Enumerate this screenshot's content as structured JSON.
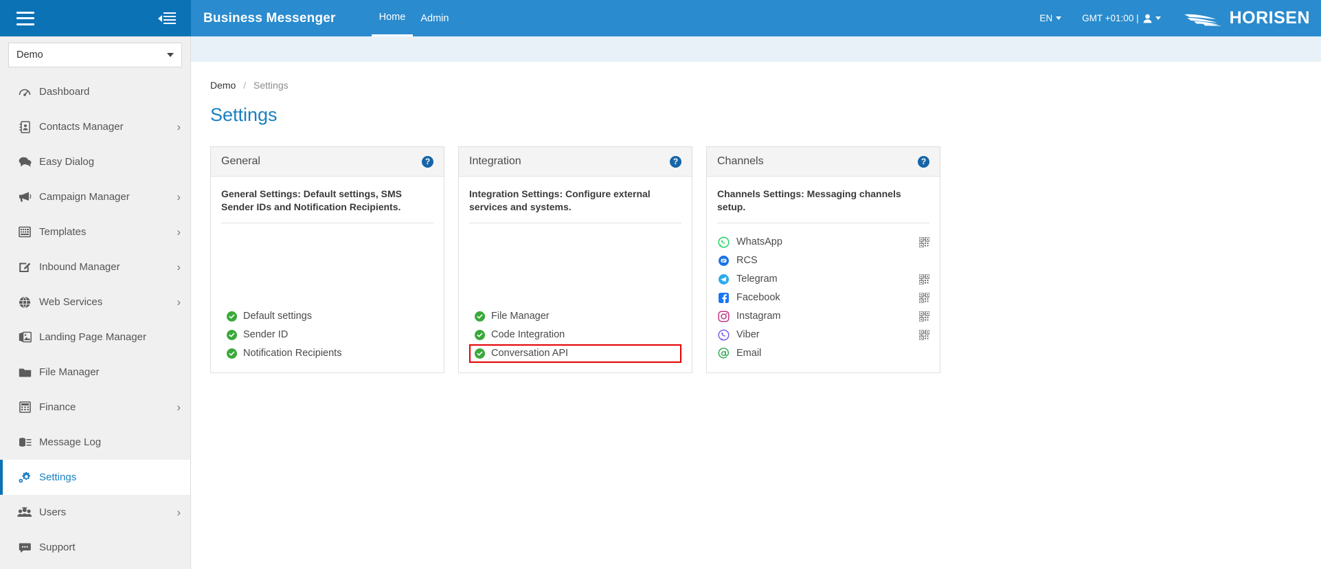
{
  "topbar": {
    "hamburger_icon": "hamburger-menu-icon",
    "collapse_icon": "collapse-sidebar-icon",
    "app_title": "Business Messenger",
    "nav": [
      {
        "label": "Home",
        "active": true
      },
      {
        "label": "Admin",
        "active": false
      }
    ],
    "language": "EN",
    "timezone": "GMT +01:00 |",
    "user_icon": "user-account-icon",
    "brand": "HORISEN",
    "brand_mark": "wing-logo-icon"
  },
  "sidebar": {
    "account_selector": {
      "value": "Demo",
      "icon": "chevron-down-icon"
    },
    "items": [
      {
        "label": "Dashboard",
        "icon": "dashboard-gauge-icon",
        "chevron": false,
        "active": false
      },
      {
        "label": "Contacts Manager",
        "icon": "contacts-book-icon",
        "chevron": true,
        "active": false
      },
      {
        "label": "Easy Dialog",
        "icon": "chat-bubbles-icon",
        "chevron": false,
        "active": false
      },
      {
        "label": "Campaign Manager",
        "icon": "megaphone-icon",
        "chevron": true,
        "active": false
      },
      {
        "label": "Templates",
        "icon": "template-grid-icon",
        "chevron": true,
        "active": false
      },
      {
        "label": "Inbound Manager",
        "icon": "edit-square-icon",
        "chevron": true,
        "active": false
      },
      {
        "label": "Web Services",
        "icon": "globe-icon",
        "chevron": true,
        "active": false
      },
      {
        "label": "Landing Page Manager",
        "icon": "images-stack-icon",
        "chevron": false,
        "active": false
      },
      {
        "label": "File Manager",
        "icon": "folder-icon",
        "chevron": false,
        "active": false
      },
      {
        "label": "Finance",
        "icon": "calculator-icon",
        "chevron": true,
        "active": false
      },
      {
        "label": "Message Log",
        "icon": "database-list-icon",
        "chevron": false,
        "active": false
      },
      {
        "label": "Settings",
        "icon": "gear-icon",
        "chevron": false,
        "active": true
      },
      {
        "label": "Users",
        "icon": "users-group-icon",
        "chevron": true,
        "active": false
      },
      {
        "label": "Support",
        "icon": "support-chat-icon",
        "chevron": false,
        "active": false
      }
    ],
    "chevron_glyph": "›"
  },
  "main": {
    "breadcrumb": {
      "home": "Demo",
      "separator": "/",
      "current": "Settings"
    },
    "page_title": "Settings",
    "cards": [
      {
        "title": "General",
        "help_icon": "help-question-icon",
        "help_glyph": "?",
        "description": "General Settings: Default settings, SMS Sender IDs and Notification Recipients.",
        "items": [
          {
            "label": "Default settings",
            "status": "enabled",
            "highlighted": false
          },
          {
            "label": "Sender ID",
            "status": "enabled",
            "highlighted": false
          },
          {
            "label": "Notification Recipients",
            "status": "enabled",
            "highlighted": false
          }
        ]
      },
      {
        "title": "Integration",
        "help_icon": "help-question-icon",
        "help_glyph": "?",
        "description": "Integration Settings: Configure external services and systems.",
        "items": [
          {
            "label": "File Manager",
            "status": "enabled",
            "highlighted": false
          },
          {
            "label": "Code Integration",
            "status": "enabled",
            "highlighted": false
          },
          {
            "label": "Conversation API",
            "status": "enabled",
            "highlighted": true
          }
        ]
      },
      {
        "title": "Channels",
        "help_icon": "help-question-icon",
        "help_glyph": "?",
        "description": "Channels Settings: Messaging channels setup.",
        "channels": [
          {
            "label": "WhatsApp",
            "icon": "whatsapp-icon",
            "qr": true
          },
          {
            "label": "RCS",
            "icon": "rcs-icon",
            "qr": false
          },
          {
            "label": "Telegram",
            "icon": "telegram-icon",
            "qr": true
          },
          {
            "label": "Facebook",
            "icon": "facebook-icon",
            "qr": true
          },
          {
            "label": "Instagram",
            "icon": "instagram-icon",
            "qr": true
          },
          {
            "label": "Viber",
            "icon": "viber-icon",
            "qr": true
          },
          {
            "label": "Email",
            "icon": "email-at-icon",
            "qr": false
          }
        ]
      }
    ]
  },
  "colors": {
    "brand_blue_dark": "#0b72b5",
    "brand_blue": "#2a8bce",
    "accent_link": "#1a7fc1",
    "status_green": "#3aa93a",
    "highlight_red": "#e60000",
    "sidebar_bg": "#f0f0f0",
    "strip_bg": "#e8f1f8"
  }
}
